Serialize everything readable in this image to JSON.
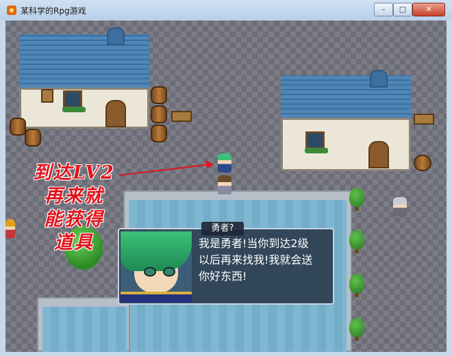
{
  "window": {
    "title": "某科学的Rpg游戏",
    "minimize": "–",
    "maximize": "□",
    "close": "✕"
  },
  "annotation": {
    "lines": [
      "到达LV2",
      "再来就",
      "能获得",
      "道具"
    ],
    "color": "#e0141c"
  },
  "dialog": {
    "speaker": "勇者?",
    "lines": [
      "我是勇者!当你到达2级",
      "以后再来找我!我就会送",
      "你好东西!"
    ]
  },
  "colors": {
    "roof": "#4f86b8",
    "wall": "#ece6d8",
    "water": "#7fb6d0",
    "cobblestone": "#7c7d87"
  }
}
